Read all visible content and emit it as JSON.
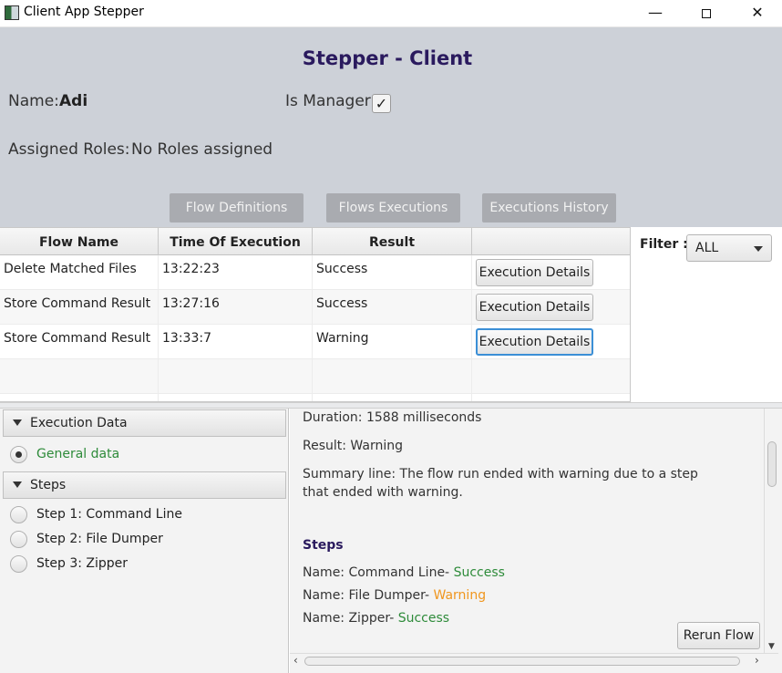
{
  "window": {
    "title": "Client App Stepper",
    "minimize": "—",
    "close": "✕"
  },
  "header": {
    "title": "Stepper - Client",
    "name_label": "Name:",
    "name_value": "Adi",
    "manager_label": "Is Manager:",
    "manager_checked": true,
    "manager_check_glyph": "✓",
    "roles_label": "Assigned Roles:",
    "roles_value": "No Roles assigned"
  },
  "nav": {
    "flow_definitions": "Flow Definitions",
    "flows_executions": "Flows Executions",
    "executions_history": "Executions History"
  },
  "table": {
    "columns": [
      "Flow Name",
      "Time Of Execution",
      "Result",
      ""
    ],
    "rows": [
      {
        "flow_name": "Delete Matched Files",
        "time": "13:22:23",
        "result": "Success",
        "action": "Execution Details"
      },
      {
        "flow_name": "Store Command Result",
        "time": "13:27:16",
        "result": "Success",
        "action": "Execution Details"
      },
      {
        "flow_name": "Store Command Result",
        "time": "13:33:7",
        "result": "Warning",
        "action": "Execution Details"
      }
    ]
  },
  "filter": {
    "label": "Filter :",
    "selected": "ALL"
  },
  "details_nav": {
    "execution_data_header": "Execution Data",
    "general_data": "General data",
    "general_data_selected": true,
    "steps_header": "Steps",
    "steps": [
      "Step 1: Command Line",
      "Step 2: File Dumper",
      "Step 3: Zipper"
    ]
  },
  "details": {
    "duration": "Duration: 1588 milliseconds",
    "result": "Result: Warning",
    "summary": "Summary line: The flow run ended with warning due to a step that ended with warning.",
    "steps_heading": "Steps",
    "step_results": [
      {
        "name": "Name: Command Line-",
        "status": "Success"
      },
      {
        "name": "Name: File Dumper-",
        "status": "Warning"
      },
      {
        "name": "Name: Zipper-",
        "status": "Success"
      }
    ],
    "rerun_button": "Rerun Flow"
  },
  "colors": {
    "title_purple": "#2a1a5e",
    "success_green": "#2e8b3a",
    "warning_orange": "#f0961e",
    "top_background": "#cdd1d8",
    "nav_button_gray": "#a9abb0",
    "focus_blue": "#3b8fd6"
  }
}
